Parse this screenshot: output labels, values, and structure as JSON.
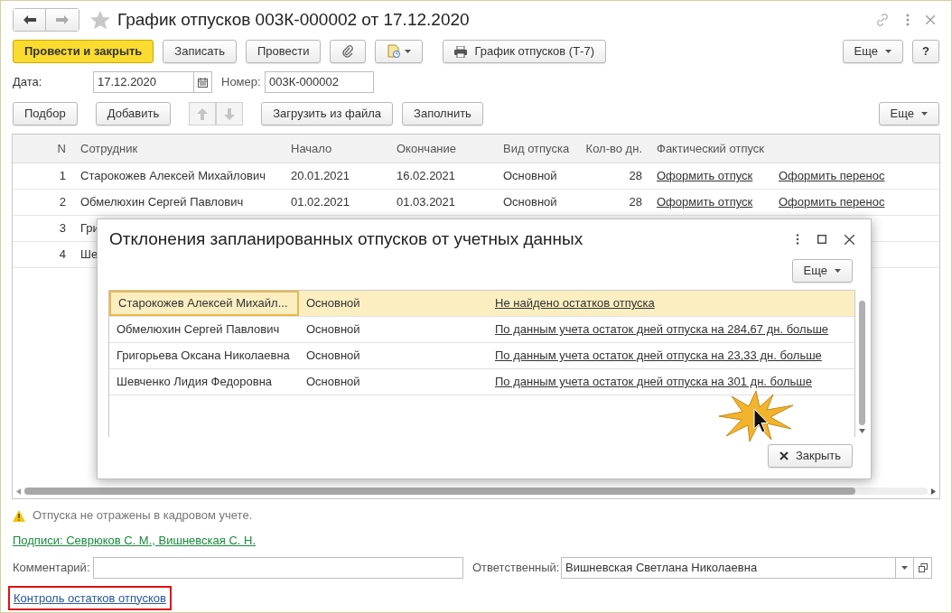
{
  "window": {
    "title": "График отпусков 003К-000002 от 17.12.2020"
  },
  "toolbar": {
    "buttons": [
      {
        "kind": "primary",
        "label": "Провести и закрыть"
      },
      {
        "kind": "plain",
        "label": "Записать"
      },
      {
        "kind": "plain",
        "label": "Провести"
      },
      {
        "kind": "attach"
      },
      {
        "kind": "docmenu"
      },
      {
        "kind": "print",
        "label": "График отпусков (Т-7)"
      }
    ],
    "more": "Еще",
    "help": "?"
  },
  "header_fields": {
    "date_label": "Дата:",
    "date": "17.12.2020",
    "number_label": "Номер:",
    "number": "003К-000002"
  },
  "table_toolbar": {
    "buttons": [
      "Подбор",
      "Добавить"
    ],
    "move_up_disabled": true,
    "move_down_disabled": true,
    "load": "Загрузить из файла",
    "fill": "Заполнить",
    "more": "Еще"
  },
  "table": {
    "columns": [
      "N",
      "Сотрудник",
      "Начало",
      "Окончание",
      "Вид отпуска",
      "Кол-во дн.",
      "Фактический отпуск"
    ],
    "rows": [
      {
        "n": "1",
        "employee": "Старокожев Алексей Михайлович",
        "start": "20.01.2021",
        "end": "16.02.2021",
        "type": "Основной",
        "days": "28",
        "link1": "Оформить отпуск",
        "link2": "Оформить перенос"
      },
      {
        "n": "2",
        "employee": "Обмелюхин Сергей Павлович",
        "start": "01.02.2021",
        "end": "01.03.2021",
        "type": "Основной",
        "days": "28",
        "link1": "Оформить отпуск",
        "link2": "Оформить перенос"
      },
      {
        "n": "3",
        "employee": "Гри"
      },
      {
        "n": "4",
        "employee": "Ше"
      }
    ]
  },
  "dialog": {
    "title": "Отклонения запланированных отпусков от учетных данных",
    "more": "Еще",
    "rows": [
      {
        "employee": "Старокожев Алексей Михайл...",
        "type": "Основной",
        "message": "Не найдено остатков отпуска",
        "selected": true
      },
      {
        "employee": "Обмелюхин Сергей Павлович",
        "type": "Основной",
        "message": "По данным учета остаток дней отпуска на 284,67 дн. больше",
        "selected": false
      },
      {
        "employee": "Григорьева Оксана Николаевна",
        "type": "Основной",
        "message": "По данным учета остаток дней отпуска на 23,33 дн. больше",
        "selected": false
      },
      {
        "employee": "Шевченко Лидия Федоровна",
        "type": "Основной",
        "message": "По данным учета остаток дней отпуска на 301 дн. больше",
        "selected": false
      }
    ],
    "close": "Закрыть"
  },
  "warning": "Отпуска не отражены в кадровом учете.",
  "signatures": "Подписи: Севрюков С. М., Вишневская С. Н.",
  "comment": {
    "label": "Комментарий:"
  },
  "responsible": {
    "label": "Ответственный:",
    "value": "Вишневская Светлана Николаевна"
  },
  "control_link": {
    "label": "Контроль остатков отпусков",
    "highlighted": true
  }
}
